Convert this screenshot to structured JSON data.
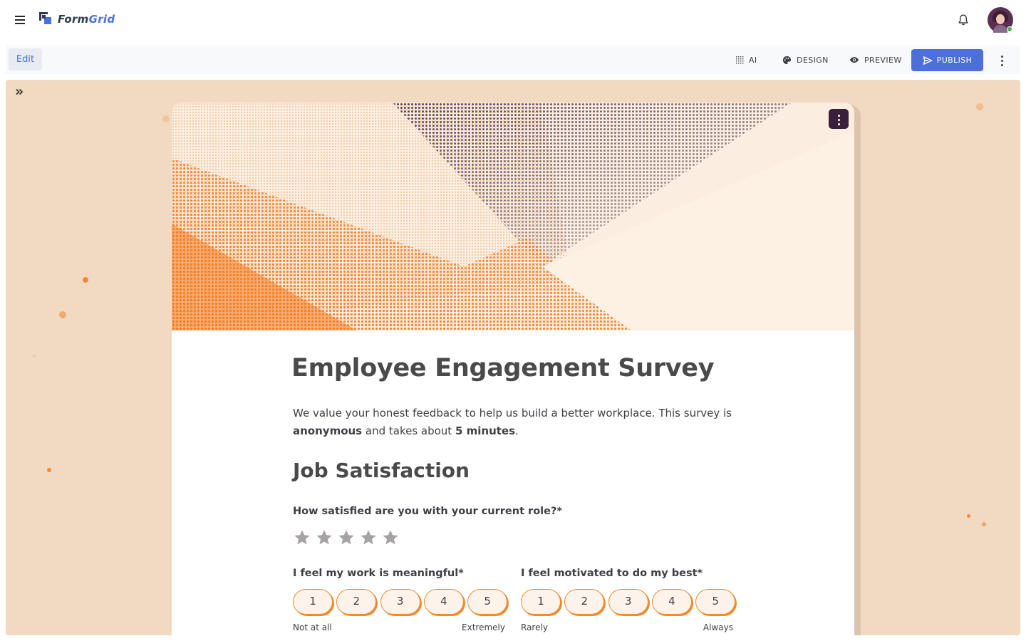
{
  "app": {
    "brand_part1": "Form",
    "brand_part2": "Grid"
  },
  "toolbar": {
    "edit_tab": "Edit",
    "ai_label": "AI",
    "design_label": "DESIGN",
    "preview_label": "PREVIEW",
    "publish_label": "PUBLISH"
  },
  "colors": {
    "accent": "#4c6fdb",
    "canvas_bg": "#f2d9c1",
    "orange": "#f08a2e",
    "banner_dark": "#3a1f3c"
  },
  "form": {
    "title": "Employee Engagement Survey",
    "intro_1": "We value your honest feedback to help us build a better workplace. This survey is ",
    "intro_bold_1": "anonymous",
    "intro_2": " and takes about ",
    "intro_bold_2": "5 minutes",
    "intro_3": ".",
    "section_title": "Job Satisfaction",
    "question_rating": {
      "label": "How satisfied are you with your current role?*",
      "max_stars": 5,
      "value": 0
    },
    "question_meaningful": {
      "label": "I feel my work is meaningful*",
      "options": [
        "1",
        "2",
        "3",
        "4",
        "5"
      ],
      "min_label": "Not at all",
      "max_label": "Extremely"
    },
    "question_motivated": {
      "label": "I feel motivated to do my best*",
      "options": [
        "1",
        "2",
        "3",
        "4",
        "5"
      ],
      "min_label": "Rarely",
      "max_label": "Always"
    }
  },
  "icons": {
    "menu": "menu-icon",
    "notifications": "bell-icon",
    "ai": "sparkle-grid-icon",
    "design": "palette-icon",
    "preview": "eye-icon",
    "publish": "send-icon",
    "more": "more-vertical-icon",
    "expand": "chevrons-right-icon",
    "rating": "star-icon"
  }
}
